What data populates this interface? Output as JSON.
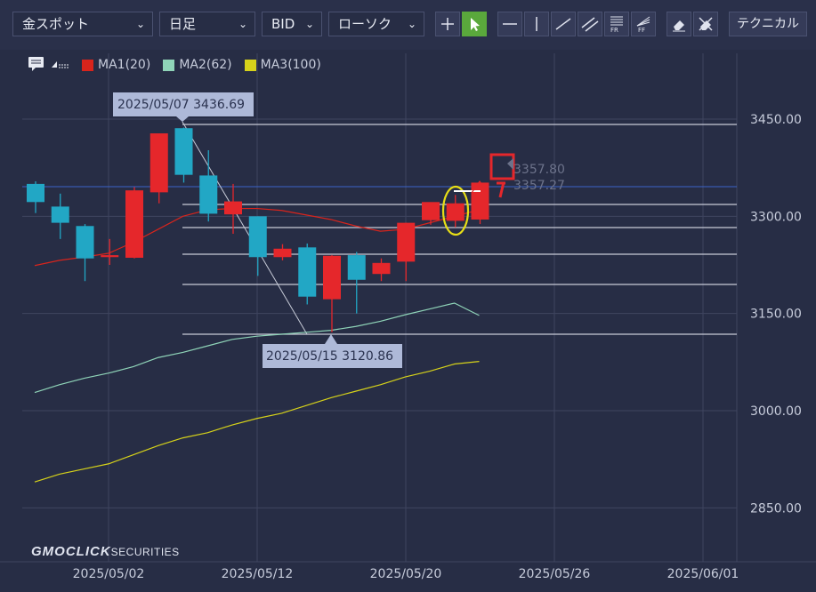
{
  "toolbar": {
    "instrument": "金スポット",
    "timeframe": "日足",
    "price_type": "BID",
    "chart_style": "ローソク",
    "technical_label": "テクニカル",
    "tools": [
      "crosshair",
      "pointer",
      "horizontal-line",
      "vertical-line",
      "trend-line",
      "channel-line",
      "fibonacci-retracement",
      "fibonacci-fan",
      "eraser",
      "erase-all"
    ]
  },
  "legend": {
    "items": [
      {
        "label": "MA1(20)",
        "color": "#d9241c"
      },
      {
        "label": "MA2(62)",
        "color": "#8fd4b8"
      },
      {
        "label": "MA3(100)",
        "color": "#d6d21a"
      }
    ]
  },
  "colors": {
    "up_candle": "#e5272b",
    "down_candle": "#22a7c5",
    "background": "#272d45",
    "grid": "#3f4560",
    "fib": "#c8ccd8",
    "current_price_line": "#3b63c9"
  },
  "annotations": {
    "high_label": "2025/05/07 3436.69",
    "low_label": "2025/05/15 3120.86"
  },
  "price_labels": {
    "ask": "3357.80",
    "bid": "3357.27"
  },
  "brand": {
    "logo": "GMOCLICK",
    "suffix": "SECURITIES"
  },
  "chart_data": {
    "type": "candlestick",
    "y_ticks": [
      "3450.00",
      "3300.00",
      "3150.00",
      "3000.00",
      "2850.00"
    ],
    "x_ticks": [
      "2025/05/02",
      "2025/05/12",
      "2025/05/20",
      "2025/05/26",
      "2025/06/01"
    ],
    "ylim": [
      2800,
      3520
    ],
    "grid": true,
    "series": [
      {
        "name": "MA1(20)",
        "values": [
          3224,
          3232,
          3237,
          3243,
          3260,
          3280,
          3300,
          3310,
          3312,
          3312,
          3309,
          3302,
          3295,
          3285,
          3277,
          3280,
          3290,
          3300,
          3310
        ]
      },
      {
        "name": "MA2(62)",
        "values": [
          3028,
          3040,
          3050,
          3058,
          3068,
          3082,
          3090,
          3100,
          3110,
          3115,
          3118,
          3121,
          3124,
          3130,
          3138,
          3148,
          3157,
          3166,
          3147
        ]
      },
      {
        "name": "MA3(100)",
        "values": [
          2890,
          2902,
          2910,
          2918,
          2932,
          2946,
          2958,
          2966,
          2978,
          2988,
          2996,
          3008,
          3020,
          3030,
          3040,
          3052,
          3061,
          3072,
          3076
        ]
      }
    ],
    "candles": [
      {
        "open": 3350,
        "high": 3354,
        "low": 3305,
        "close": 3322
      },
      {
        "open": 3315,
        "high": 3335,
        "low": 3265,
        "close": 3290
      },
      {
        "open": 3285,
        "high": 3288,
        "low": 3200,
        "close": 3235
      },
      {
        "open": 3237,
        "high": 3265,
        "low": 3225,
        "close": 3240
      },
      {
        "open": 3236,
        "high": 3345,
        "low": 3235,
        "close": 3340
      },
      {
        "open": 3337,
        "high": 3428,
        "low": 3320,
        "close": 3428
      },
      {
        "open": 3436,
        "high": 3437,
        "low": 3352,
        "close": 3364
      },
      {
        "open": 3363,
        "high": 3402,
        "low": 3292,
        "close": 3304
      },
      {
        "open": 3303,
        "high": 3350,
        "low": 3273,
        "close": 3323
      },
      {
        "open": 3300,
        "high": 3300,
        "low": 3208,
        "close": 3237
      },
      {
        "open": 3237,
        "high": 3257,
        "low": 3232,
        "close": 3250
      },
      {
        "open": 3252,
        "high": 3258,
        "low": 3164,
        "close": 3176
      },
      {
        "open": 3172,
        "high": 3240,
        "low": 3121,
        "close": 3239
      },
      {
        "open": 3240,
        "high": 3245,
        "low": 3150,
        "close": 3202
      },
      {
        "open": 3211,
        "high": 3235,
        "low": 3200,
        "close": 3228
      },
      {
        "open": 3230,
        "high": 3290,
        "low": 3200,
        "close": 3290
      },
      {
        "open": 3294,
        "high": 3320,
        "low": 3287,
        "close": 3322
      },
      {
        "open": 3293,
        "high": 3333,
        "low": 3283,
        "close": 3320
      },
      {
        "open": 3295,
        "high": 3352,
        "low": 3288,
        "close": 3352
      }
    ]
  }
}
